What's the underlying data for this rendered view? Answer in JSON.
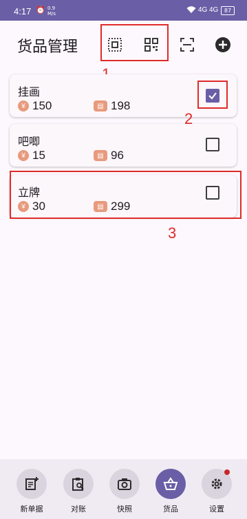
{
  "status_bar": {
    "time": "4:17",
    "speed_value": "0.9",
    "speed_unit": "M/s",
    "signal_1": "4G",
    "signal_2": "4G",
    "battery": "87"
  },
  "header": {
    "title": "货品管理"
  },
  "annotations": {
    "a1": "1",
    "a2": "2",
    "a3": "3"
  },
  "items": [
    {
      "name": "挂画",
      "price": "150",
      "stock": "198",
      "checked": true
    },
    {
      "name": "吧唧",
      "price": "15",
      "stock": "96",
      "checked": false
    },
    {
      "name": "立牌",
      "price": "30",
      "stock": "299",
      "checked": false
    }
  ],
  "currency_symbol": "¥",
  "bottom_nav": {
    "new_order": "新单据",
    "reconcile": "对账",
    "snapshot": "快照",
    "goods": "货品",
    "settings": "设置"
  },
  "colors": {
    "primary": "#6a5fa6",
    "accent_icon": "#e89a7d",
    "annotation": "#e02a2a"
  }
}
